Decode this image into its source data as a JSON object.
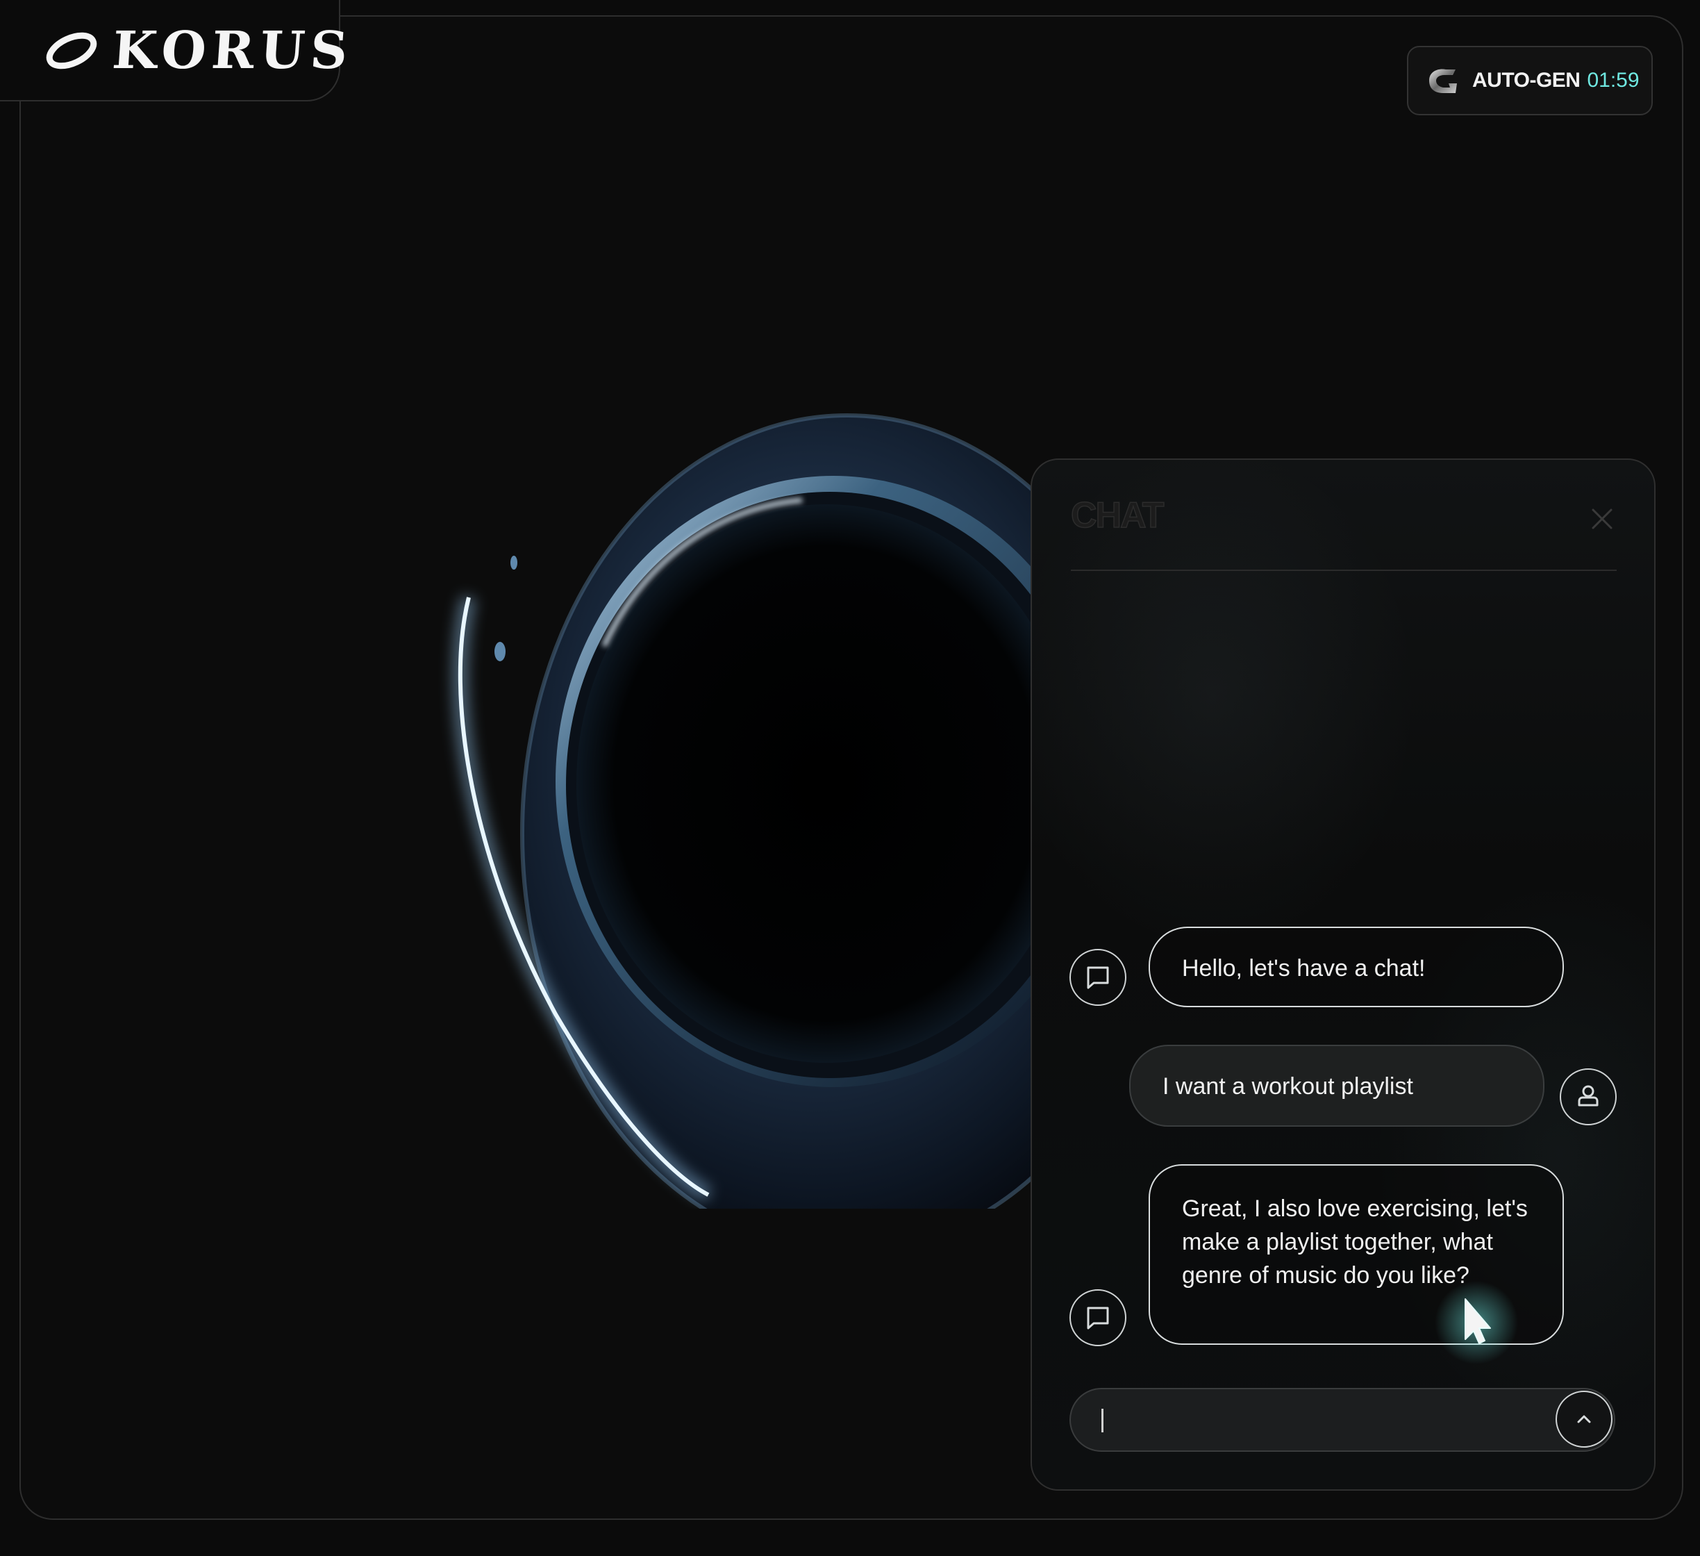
{
  "app": {
    "brand": "KORUS"
  },
  "autogen": {
    "label": "AUTO-GEN",
    "time": "01:59",
    "accent": "#6fe7e0"
  },
  "chat": {
    "title": "CHAT",
    "messages": [
      {
        "role": "bot",
        "text": "Hello, let's have a chat!"
      },
      {
        "role": "user",
        "text": "I want a workout playlist"
      },
      {
        "role": "bot",
        "text": "Great, I also love exercising, let's make a playlist together, what genre of music do you like?"
      }
    ],
    "input": {
      "value": "",
      "placeholder": ""
    }
  },
  "icons": {
    "close": "close-icon",
    "bot_avatar": "chat-bubble-icon",
    "user_avatar": "user-icon",
    "send": "chevron-up-icon",
    "autogen": "autogen-icon",
    "cursor": "pointer-cursor-icon"
  }
}
